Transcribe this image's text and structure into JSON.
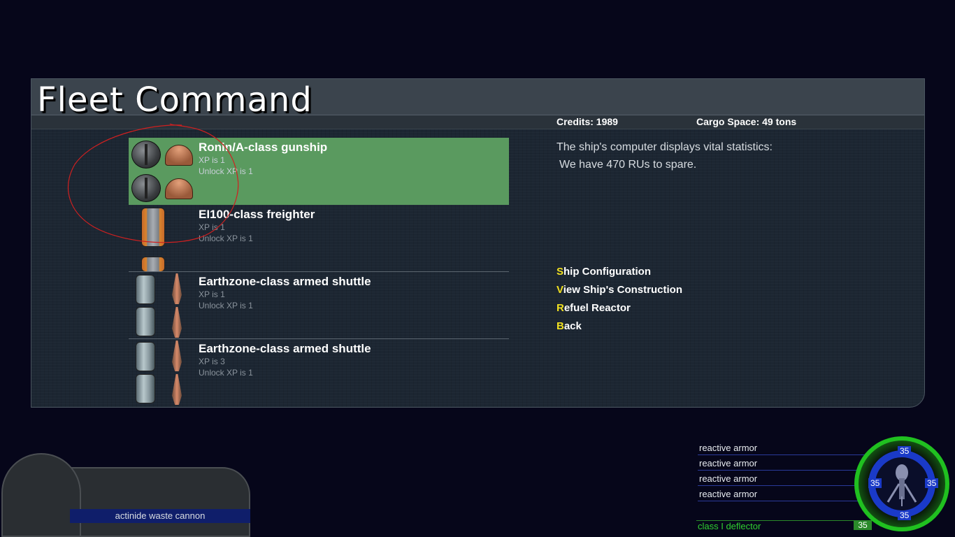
{
  "window": {
    "title": "Fleet Command"
  },
  "header": {
    "credits": "Credits: 1989",
    "cargo": "Cargo Space:  49 tons"
  },
  "ships": [
    {
      "name": "Ronin/A-class gunship",
      "xp": "XP is 1",
      "unlock": "Unlock XP is 1",
      "selected": true
    },
    {
      "name": "EI100-class freighter",
      "xp": "XP is 1",
      "unlock": "Unlock XP is 1",
      "selected": false
    },
    {
      "name": "Earthzone-class armed shuttle",
      "xp": "XP is 1",
      "unlock": "Unlock XP is 1",
      "selected": false
    },
    {
      "name": "Earthzone-class armed shuttle",
      "xp": "XP is 3",
      "unlock": "Unlock XP is 1",
      "selected": false
    }
  ],
  "info": {
    "line1": "The ship's computer displays vital statistics:",
    "line2": "We have 470 RUs to spare."
  },
  "menu": [
    {
      "hot": "S",
      "rest": "hip Configuration"
    },
    {
      "hot": "V",
      "rest": "iew Ship's Construction"
    },
    {
      "hot": "R",
      "rest": "efuel Reactor"
    },
    {
      "hot": "B",
      "rest": "ack"
    }
  ],
  "weapon": {
    "label": "actinide waste cannon"
  },
  "armor": [
    "reactive armor",
    "reactive armor",
    "reactive armor",
    "reactive armor"
  ],
  "deflector": {
    "label": "class I deflector",
    "value": "35"
  },
  "shield": {
    "top": "35",
    "left": "35",
    "right": "35",
    "bottom": "35"
  },
  "colors": {
    "selected_row": "#5a9a5f",
    "hotkey": "#f0e020",
    "shield_green": "#20c020",
    "shield_blue": "#1a3ac8",
    "annotation": "#d02020"
  }
}
